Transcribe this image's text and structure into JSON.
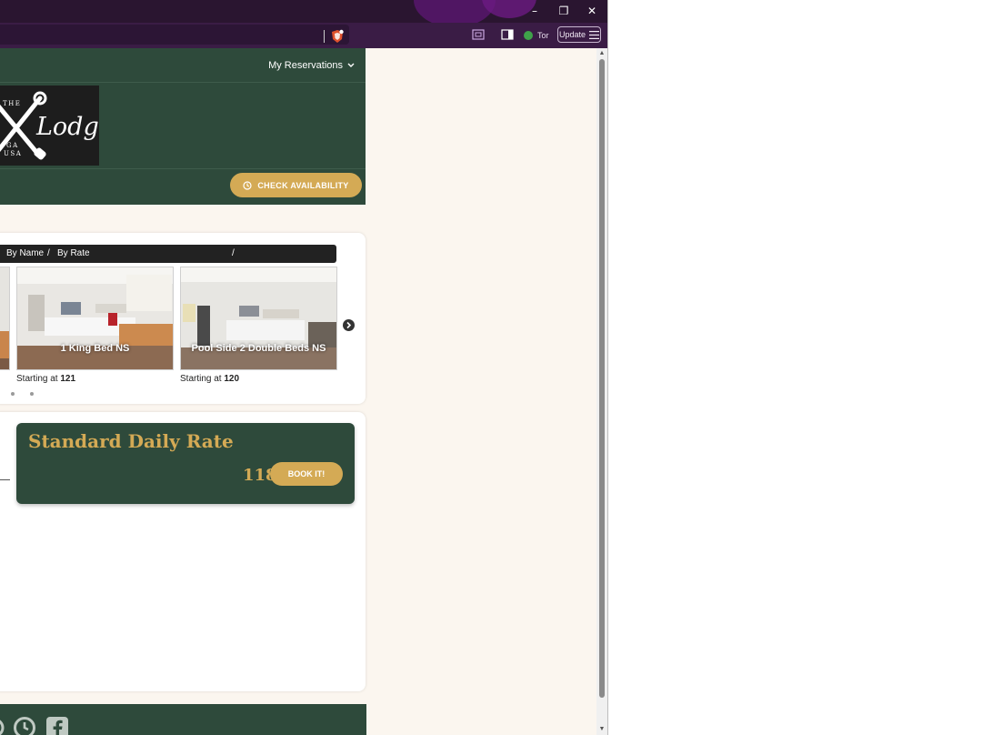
{
  "browser": {
    "window_buttons": {
      "minimize": "–",
      "restore": "❐",
      "close": "✕"
    },
    "tor_label": "Tor",
    "update_label": "Update"
  },
  "header": {
    "reservations_label": "My Reservations",
    "logo": {
      "top_text": "THE",
      "main_text": "Lodge",
      "sub_text1": "GA",
      "sub_text2": "USA"
    },
    "check_availability_label": "CHECK AVAILABILITY"
  },
  "sort": {
    "by_name": "By Name",
    "separator": "/",
    "by_rate": "By Rate",
    "separator2": "/"
  },
  "rooms": [
    {
      "name": "1 King Bed NS",
      "price_prefix": "Starting at",
      "price": "121"
    },
    {
      "name": "Pool Side 2 Double Beds NS",
      "price_prefix": "Starting at",
      "price": "120"
    }
  ],
  "rate_card": {
    "title": "Standard Daily Rate",
    "amount": "118",
    "book_label": "BOOK IT!"
  },
  "colors": {
    "header_green": "#2e4a3b",
    "accent_gold": "#d4aa55",
    "page_bg": "#fbf6ef",
    "browser_purple": "#3a1c45"
  },
  "icons": {
    "shield": "brave-shield-icon",
    "reader": "reader-mode-icon",
    "sidebar": "sidebar-icon",
    "menu": "hamburger-menu-icon",
    "clock": "clock-icon",
    "chevron": "chevron-down-icon",
    "next": "carousel-next-icon",
    "facebook": "facebook-icon"
  }
}
